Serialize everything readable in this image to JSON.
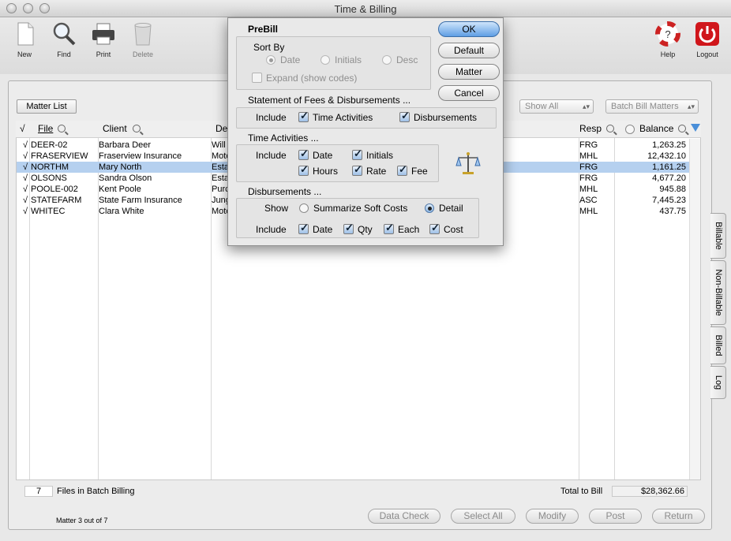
{
  "window": {
    "title": "Time & Billing"
  },
  "toolbar": {
    "new": "New",
    "find": "Find",
    "print": "Print",
    "delete": "Delete",
    "help": "Help",
    "logout": "Logout"
  },
  "controls": {
    "matter_list": "Matter List",
    "show_filter": "Show All",
    "batch_bill": "Batch Bill Matters"
  },
  "table": {
    "check_header": "√",
    "headers": {
      "file": "File",
      "client": "Client",
      "desc": "De",
      "resp": "Resp",
      "balance": "Balance"
    },
    "rows": [
      {
        "check": "√",
        "file": "DEER-02",
        "client": "Barbara Deer",
        "desc": "Will",
        "resp": "FRG",
        "balance": "1,263.25"
      },
      {
        "check": "√",
        "file": "FRASERVIEW",
        "client": "Fraserview Insurance",
        "desc": "Moto",
        "resp": "MHL",
        "balance": "12,432.10"
      },
      {
        "check": "√",
        "file": "NORTHM",
        "client": "Mary North",
        "desc": "Esta",
        "resp": "FRG",
        "balance": "1,161.25"
      },
      {
        "check": "√",
        "file": "OLSONS",
        "client": "Sandra Olson",
        "desc": "Esta",
        "resp": "FRG",
        "balance": "4,677.20"
      },
      {
        "check": "√",
        "file": "POOLE-002",
        "client": "Kent Poole",
        "desc": "Purc",
        "resp": "MHL",
        "balance": "945.88"
      },
      {
        "check": "√",
        "file": "STATEFARM",
        "client": "State Farm Insurance",
        "desc": "Jung",
        "resp": "ASC",
        "balance": "7,445.23"
      },
      {
        "check": "√",
        "file": "WHITEC",
        "client": "Clara White",
        "desc": "Moto",
        "resp": "MHL",
        "balance": "437.75"
      }
    ],
    "selected_index": 2
  },
  "footer": {
    "files_count": "7",
    "files_label": "Files in Batch Billing",
    "total_label": "Total to Bill",
    "total_value": "$28,362.66",
    "status": "Matter 3 out of 7"
  },
  "buttons": {
    "data_check": "Data Check",
    "select_all": "Select All",
    "modify": "Modify",
    "post": "Post",
    "return": "Return"
  },
  "side_tabs": [
    "Billable",
    "Non-Billable",
    "Billed",
    "Log"
  ],
  "dialog": {
    "title": "PreBill",
    "sort_by": {
      "label": "Sort By",
      "options": [
        "Date",
        "Initials",
        "Desc"
      ],
      "selected": "Date",
      "expand_label": "Expand (show codes)"
    },
    "statement": {
      "label": "Statement of Fees & Disbursements ...",
      "include": "Include",
      "time_activities": "Time Activities",
      "disbursements": "Disbursements"
    },
    "time_activities": {
      "label": "Time Activities ...",
      "include": "Include",
      "date": "Date",
      "initials": "Initials",
      "hours": "Hours",
      "rate": "Rate",
      "fee": "Fee"
    },
    "disbursements": {
      "label": "Disbursements ...",
      "show": "Show",
      "summarize": "Summarize Soft Costs",
      "detail": "Detail",
      "include": "Include",
      "date": "Date",
      "qty": "Qty",
      "each": "Each",
      "cost": "Cost"
    },
    "buttons": {
      "ok": "OK",
      "default": "Default",
      "matter": "Matter",
      "cancel": "Cancel"
    }
  },
  "colors": {
    "accent": "#5f9ee4",
    "selection": "#b5d0ef",
    "logout": "#d0161b"
  }
}
